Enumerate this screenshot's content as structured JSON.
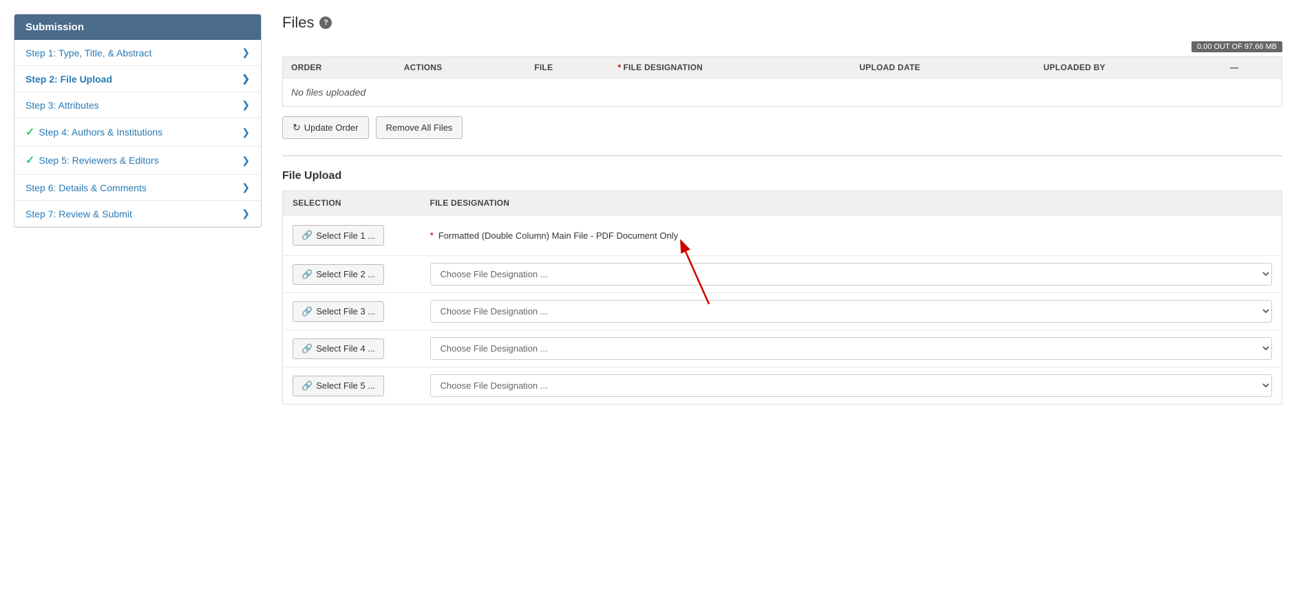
{
  "sidebar": {
    "title": "Submission",
    "items": [
      {
        "id": "step1",
        "label": "Step 1: Type, Title, & Abstract",
        "active": false,
        "checked": false
      },
      {
        "id": "step2",
        "label": "Step 2: File Upload",
        "active": true,
        "checked": false
      },
      {
        "id": "step3",
        "label": "Step 3: Attributes",
        "active": false,
        "checked": false
      },
      {
        "id": "step4",
        "label": "Step 4: Authors & Institutions",
        "active": false,
        "checked": true
      },
      {
        "id": "step5",
        "label": "Step 5: Reviewers & Editors",
        "active": false,
        "checked": true
      },
      {
        "id": "step6",
        "label": "Step 6: Details & Comments",
        "active": false,
        "checked": false
      },
      {
        "id": "step7",
        "label": "Step 7: Review & Submit",
        "active": false,
        "checked": false
      }
    ]
  },
  "page": {
    "title": "Files",
    "quota": "0.00 OUT OF 97.66 MB"
  },
  "files_table": {
    "columns": [
      "ORDER",
      "ACTIONS",
      "FILE",
      "FILE DESIGNATION",
      "UPLOAD DATE",
      "UPLOADED BY"
    ],
    "empty_message": "No files uploaded"
  },
  "buttons": {
    "update_order": "Update Order",
    "remove_all": "Remove All Files"
  },
  "upload_section": {
    "title": "File Upload",
    "columns": [
      "SELECTION",
      "FILE DESIGNATION"
    ],
    "rows": [
      {
        "id": 1,
        "button_label": "Select File 1 ...",
        "designation_text": "Formatted (Double Column) Main File - PDF Document Only",
        "is_required": true,
        "is_dropdown": false
      },
      {
        "id": 2,
        "button_label": "Select File 2 ...",
        "designation_placeholder": "Choose File Designation ...",
        "is_required": false,
        "is_dropdown": true
      },
      {
        "id": 3,
        "button_label": "Select File 3 ...",
        "designation_placeholder": "Choose File Designation ...",
        "is_required": false,
        "is_dropdown": true
      },
      {
        "id": 4,
        "button_label": "Select File 4 ...",
        "designation_placeholder": "Choose File Designation ...",
        "is_required": false,
        "is_dropdown": true
      },
      {
        "id": 5,
        "button_label": "Select File 5 ...",
        "designation_placeholder": "Choose File Designation ...",
        "is_required": false,
        "is_dropdown": true
      }
    ]
  },
  "icons": {
    "chevron": "❯",
    "check": "✓",
    "refresh": "↻",
    "paperclip": "🔗",
    "help": "?"
  }
}
